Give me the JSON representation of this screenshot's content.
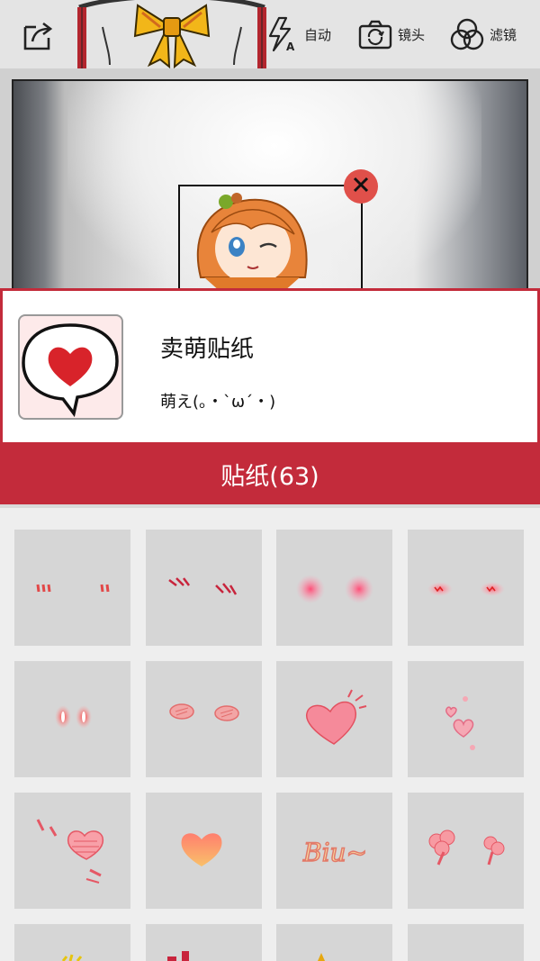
{
  "toolbar": {
    "share_icon": "share-export-icon",
    "auto_icon": "flash-auto-icon",
    "auto_label": "自动",
    "lens_icon": "camera-switch-icon",
    "lens_label": "镜头",
    "filter_icon": "filter-circles-icon",
    "filter_label": "滤镜"
  },
  "preview": {
    "sticker_close_icon": "close-icon"
  },
  "sticker_pack": {
    "title": "卖萌贴纸",
    "description": "萌え(。・`ω´・)",
    "thumbnail_icon": "heart-speech-bubble-icon"
  },
  "action": {
    "label": "贴纸(63)"
  },
  "stickers": [
    {
      "name": "blush-lines-sticker"
    },
    {
      "name": "blush-slashes-sticker"
    },
    {
      "name": "pink-glow-cheeks-sticker"
    },
    {
      "name": "red-scribble-cheeks-sticker"
    },
    {
      "name": "glowing-eyes-sticker"
    },
    {
      "name": "oval-blush-sticker"
    },
    {
      "name": "scribble-heart-sticker"
    },
    {
      "name": "small-hearts-sticker"
    },
    {
      "name": "striped-heart-sticker"
    },
    {
      "name": "orange-heart-sticker"
    },
    {
      "name": "biu-text-sticker"
    },
    {
      "name": "pink-clouds-sticker"
    },
    {
      "name": "partial-sticker-1"
    },
    {
      "name": "partial-sticker-2"
    },
    {
      "name": "partial-sticker-3"
    },
    {
      "name": "partial-sticker-4"
    }
  ],
  "colors": {
    "accent": "#c32b3b",
    "close": "#e0504a"
  }
}
